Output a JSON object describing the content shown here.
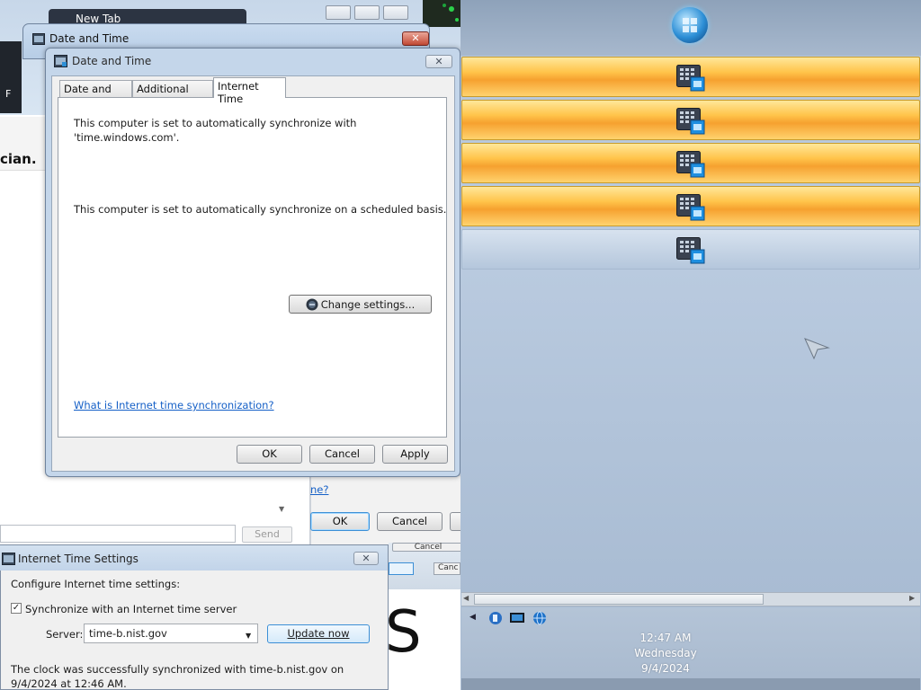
{
  "background": {
    "browser_tab_label": "New Tab",
    "side_tab_letter": "F",
    "brand_fragment": "cian.",
    "send_label": "Send",
    "link_fragment": "ne?",
    "ok_label": "OK",
    "cancel_label": "Cancel",
    "cancel_small_label": "Cancel",
    "cancel_fragment": "Canc",
    "big_letter": "S"
  },
  "back_dialog": {
    "title": "Date and Time",
    "close_label": "✕"
  },
  "dialog": {
    "title": "Date and Time",
    "close_label": "✕",
    "tabs": [
      {
        "label": "Date and Time"
      },
      {
        "label": "Additional Clocks"
      },
      {
        "label": "Internet Time"
      }
    ],
    "sync_text_1": "This computer is set to automatically synchronize with 'time.windows.com'.",
    "sync_text_2": "This computer is set to automatically synchronize on a scheduled basis.",
    "change_settings_label": "Change settings...",
    "help_link": "What is Internet time synchronization?",
    "buttons": {
      "ok": "OK",
      "cancel": "Cancel",
      "apply": "Apply"
    }
  },
  "internet_time_settings": {
    "title": "Internet Time Settings",
    "close_label": "✕",
    "configure_label": "Configure Internet time settings:",
    "sync_checkbox_label": "Synchronize with an Internet time server",
    "sync_checked": true,
    "server_label": "Server:",
    "server_value": "time-b.nist.gov",
    "update_button": "Update now",
    "status_text": "The clock was successfully synchronized with time-b.nist.gov on 9/4/2024 at 12:46 AM."
  },
  "side_panel": {
    "bars": [
      {
        "style": "orange",
        "icon": "calendar-clock-icon"
      },
      {
        "style": "orange",
        "icon": "calendar-clock-icon"
      },
      {
        "style": "orange",
        "icon": "calendar-clock-icon"
      },
      {
        "style": "orange",
        "icon": "calendar-clock-icon"
      },
      {
        "style": "blue",
        "icon": "calendar-clock-icon"
      }
    ],
    "clock": {
      "time": "12:47 AM",
      "day": "Wednesday",
      "date": "9/4/2024"
    }
  },
  "colors": {
    "accent_orange": "#f6a12f",
    "link_blue": "#1560c7",
    "panel_blue": "#b7c8dc"
  }
}
